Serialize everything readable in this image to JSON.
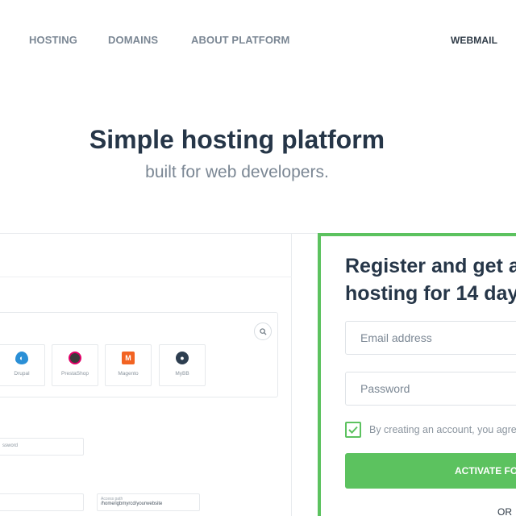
{
  "nav": {
    "hosting": "HOSTING",
    "domains": "DOMAINS",
    "about": "ABOUT PLATFORM",
    "webmail": "WEBMAIL"
  },
  "hero": {
    "title": "Simple hosting platform",
    "subtitle": "built for web developers."
  },
  "preview": {
    "apps": [
      "Drupal",
      "PrestaShop",
      "Magento",
      "MyBB"
    ],
    "password_label": "ssword",
    "access_path_label": "Access path",
    "access_path_value": "/home/igbmyrcd/yourwebsite"
  },
  "register": {
    "title_line1": "Register and get a",
    "title_line2": "hosting for 14 day",
    "email_placeholder": "Email address",
    "password_placeholder": "Password",
    "terms": "By creating an account, you agree",
    "button": "ACTIVATE FO",
    "or": "OR"
  },
  "colors": {
    "accent": "#5cc25f",
    "heading": "#263648",
    "muted": "#7b8794"
  }
}
